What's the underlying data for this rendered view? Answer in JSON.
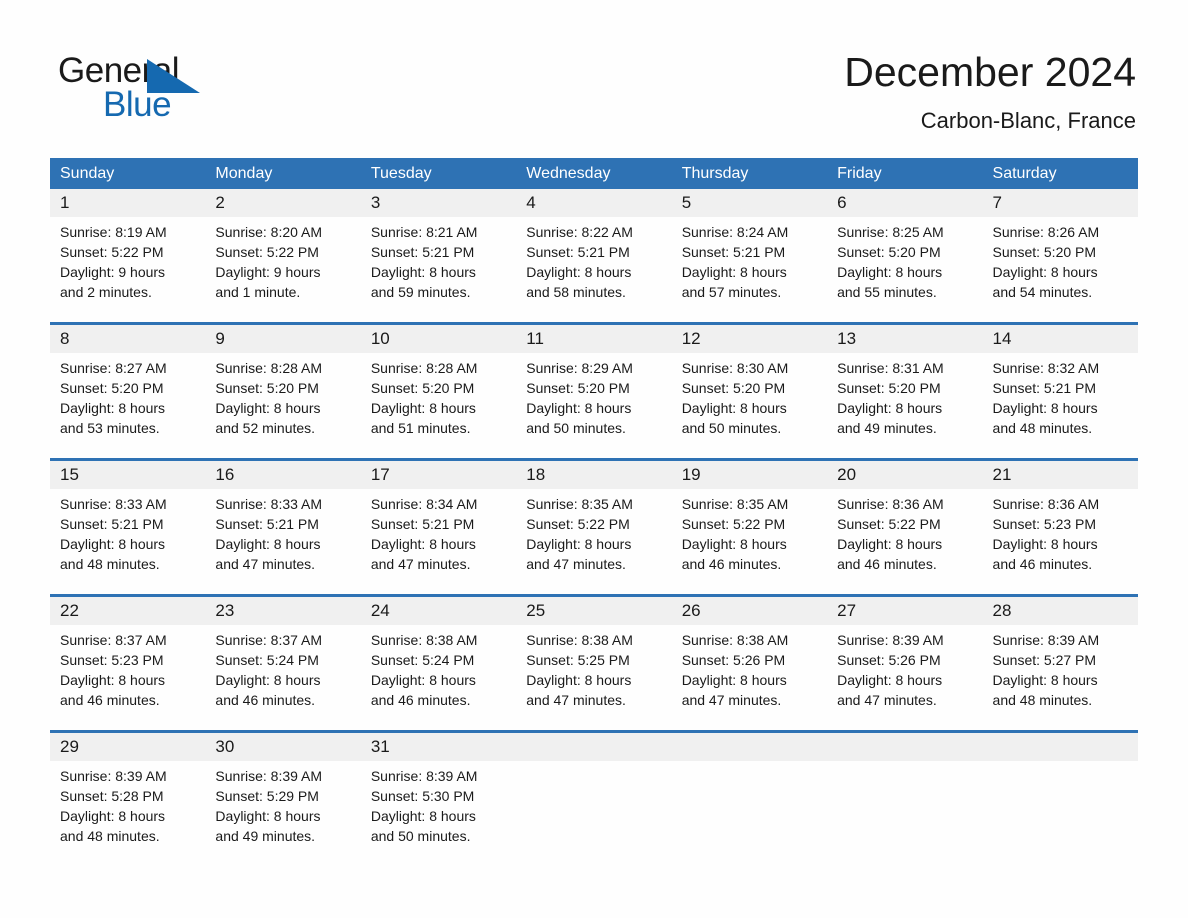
{
  "brand": {
    "name_part1": "General",
    "name_part2": "Blue",
    "accent_color": "#1569b0"
  },
  "header": {
    "month_title": "December 2024",
    "location": "Carbon-Blanc, France"
  },
  "calendar": {
    "header_color": "#2e72b4",
    "daynum_band_color": "#f0f0f0",
    "day_names": [
      "Sunday",
      "Monday",
      "Tuesday",
      "Wednesday",
      "Thursday",
      "Friday",
      "Saturday"
    ],
    "weeks": [
      {
        "days": [
          {
            "num": "1",
            "sunrise": "Sunrise: 8:19 AM",
            "sunset": "Sunset: 5:22 PM",
            "daylight1": "Daylight: 9 hours",
            "daylight2": "and 2 minutes."
          },
          {
            "num": "2",
            "sunrise": "Sunrise: 8:20 AM",
            "sunset": "Sunset: 5:22 PM",
            "daylight1": "Daylight: 9 hours",
            "daylight2": "and 1 minute."
          },
          {
            "num": "3",
            "sunrise": "Sunrise: 8:21 AM",
            "sunset": "Sunset: 5:21 PM",
            "daylight1": "Daylight: 8 hours",
            "daylight2": "and 59 minutes."
          },
          {
            "num": "4",
            "sunrise": "Sunrise: 8:22 AM",
            "sunset": "Sunset: 5:21 PM",
            "daylight1": "Daylight: 8 hours",
            "daylight2": "and 58 minutes."
          },
          {
            "num": "5",
            "sunrise": "Sunrise: 8:24 AM",
            "sunset": "Sunset: 5:21 PM",
            "daylight1": "Daylight: 8 hours",
            "daylight2": "and 57 minutes."
          },
          {
            "num": "6",
            "sunrise": "Sunrise: 8:25 AM",
            "sunset": "Sunset: 5:20 PM",
            "daylight1": "Daylight: 8 hours",
            "daylight2": "and 55 minutes."
          },
          {
            "num": "7",
            "sunrise": "Sunrise: 8:26 AM",
            "sunset": "Sunset: 5:20 PM",
            "daylight1": "Daylight: 8 hours",
            "daylight2": "and 54 minutes."
          }
        ]
      },
      {
        "days": [
          {
            "num": "8",
            "sunrise": "Sunrise: 8:27 AM",
            "sunset": "Sunset: 5:20 PM",
            "daylight1": "Daylight: 8 hours",
            "daylight2": "and 53 minutes."
          },
          {
            "num": "9",
            "sunrise": "Sunrise: 8:28 AM",
            "sunset": "Sunset: 5:20 PM",
            "daylight1": "Daylight: 8 hours",
            "daylight2": "and 52 minutes."
          },
          {
            "num": "10",
            "sunrise": "Sunrise: 8:28 AM",
            "sunset": "Sunset: 5:20 PM",
            "daylight1": "Daylight: 8 hours",
            "daylight2": "and 51 minutes."
          },
          {
            "num": "11",
            "sunrise": "Sunrise: 8:29 AM",
            "sunset": "Sunset: 5:20 PM",
            "daylight1": "Daylight: 8 hours",
            "daylight2": "and 50 minutes."
          },
          {
            "num": "12",
            "sunrise": "Sunrise: 8:30 AM",
            "sunset": "Sunset: 5:20 PM",
            "daylight1": "Daylight: 8 hours",
            "daylight2": "and 50 minutes."
          },
          {
            "num": "13",
            "sunrise": "Sunrise: 8:31 AM",
            "sunset": "Sunset: 5:20 PM",
            "daylight1": "Daylight: 8 hours",
            "daylight2": "and 49 minutes."
          },
          {
            "num": "14",
            "sunrise": "Sunrise: 8:32 AM",
            "sunset": "Sunset: 5:21 PM",
            "daylight1": "Daylight: 8 hours",
            "daylight2": "and 48 minutes."
          }
        ]
      },
      {
        "days": [
          {
            "num": "15",
            "sunrise": "Sunrise: 8:33 AM",
            "sunset": "Sunset: 5:21 PM",
            "daylight1": "Daylight: 8 hours",
            "daylight2": "and 48 minutes."
          },
          {
            "num": "16",
            "sunrise": "Sunrise: 8:33 AM",
            "sunset": "Sunset: 5:21 PM",
            "daylight1": "Daylight: 8 hours",
            "daylight2": "and 47 minutes."
          },
          {
            "num": "17",
            "sunrise": "Sunrise: 8:34 AM",
            "sunset": "Sunset: 5:21 PM",
            "daylight1": "Daylight: 8 hours",
            "daylight2": "and 47 minutes."
          },
          {
            "num": "18",
            "sunrise": "Sunrise: 8:35 AM",
            "sunset": "Sunset: 5:22 PM",
            "daylight1": "Daylight: 8 hours",
            "daylight2": "and 47 minutes."
          },
          {
            "num": "19",
            "sunrise": "Sunrise: 8:35 AM",
            "sunset": "Sunset: 5:22 PM",
            "daylight1": "Daylight: 8 hours",
            "daylight2": "and 46 minutes."
          },
          {
            "num": "20",
            "sunrise": "Sunrise: 8:36 AM",
            "sunset": "Sunset: 5:22 PM",
            "daylight1": "Daylight: 8 hours",
            "daylight2": "and 46 minutes."
          },
          {
            "num": "21",
            "sunrise": "Sunrise: 8:36 AM",
            "sunset": "Sunset: 5:23 PM",
            "daylight1": "Daylight: 8 hours",
            "daylight2": "and 46 minutes."
          }
        ]
      },
      {
        "days": [
          {
            "num": "22",
            "sunrise": "Sunrise: 8:37 AM",
            "sunset": "Sunset: 5:23 PM",
            "daylight1": "Daylight: 8 hours",
            "daylight2": "and 46 minutes."
          },
          {
            "num": "23",
            "sunrise": "Sunrise: 8:37 AM",
            "sunset": "Sunset: 5:24 PM",
            "daylight1": "Daylight: 8 hours",
            "daylight2": "and 46 minutes."
          },
          {
            "num": "24",
            "sunrise": "Sunrise: 8:38 AM",
            "sunset": "Sunset: 5:24 PM",
            "daylight1": "Daylight: 8 hours",
            "daylight2": "and 46 minutes."
          },
          {
            "num": "25",
            "sunrise": "Sunrise: 8:38 AM",
            "sunset": "Sunset: 5:25 PM",
            "daylight1": "Daylight: 8 hours",
            "daylight2": "and 47 minutes."
          },
          {
            "num": "26",
            "sunrise": "Sunrise: 8:38 AM",
            "sunset": "Sunset: 5:26 PM",
            "daylight1": "Daylight: 8 hours",
            "daylight2": "and 47 minutes."
          },
          {
            "num": "27",
            "sunrise": "Sunrise: 8:39 AM",
            "sunset": "Sunset: 5:26 PM",
            "daylight1": "Daylight: 8 hours",
            "daylight2": "and 47 minutes."
          },
          {
            "num": "28",
            "sunrise": "Sunrise: 8:39 AM",
            "sunset": "Sunset: 5:27 PM",
            "daylight1": "Daylight: 8 hours",
            "daylight2": "and 48 minutes."
          }
        ]
      },
      {
        "days": [
          {
            "num": "29",
            "sunrise": "Sunrise: 8:39 AM",
            "sunset": "Sunset: 5:28 PM",
            "daylight1": "Daylight: 8 hours",
            "daylight2": "and 48 minutes."
          },
          {
            "num": "30",
            "sunrise": "Sunrise: 8:39 AM",
            "sunset": "Sunset: 5:29 PM",
            "daylight1": "Daylight: 8 hours",
            "daylight2": "and 49 minutes."
          },
          {
            "num": "31",
            "sunrise": "Sunrise: 8:39 AM",
            "sunset": "Sunset: 5:30 PM",
            "daylight1": "Daylight: 8 hours",
            "daylight2": "and 50 minutes."
          },
          {
            "num": "",
            "sunrise": "",
            "sunset": "",
            "daylight1": "",
            "daylight2": ""
          },
          {
            "num": "",
            "sunrise": "",
            "sunset": "",
            "daylight1": "",
            "daylight2": ""
          },
          {
            "num": "",
            "sunrise": "",
            "sunset": "",
            "daylight1": "",
            "daylight2": ""
          },
          {
            "num": "",
            "sunrise": "",
            "sunset": "",
            "daylight1": "",
            "daylight2": ""
          }
        ]
      }
    ]
  }
}
